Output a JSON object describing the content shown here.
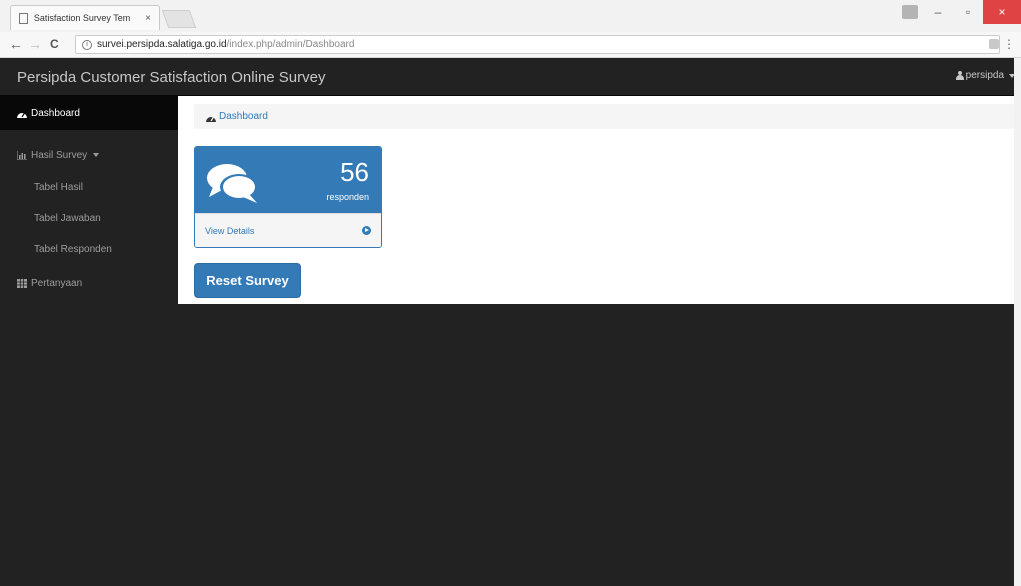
{
  "browser": {
    "tab_title": "Satisfaction Survey Tem",
    "tab_close": "×",
    "url_host": "survei.persipda.salatiga.go.id",
    "url_path": "/index.php/admin/Dashboard",
    "back": "←",
    "forward": "→",
    "reload": "C",
    "minimize": "–",
    "restore": "▫",
    "close": "×",
    "menu": "⋮"
  },
  "navbar": {
    "brand": "Persipda Customer Satisfaction Online Survey",
    "user": "persipda"
  },
  "sidebar": {
    "items": [
      {
        "label": "Dashboard",
        "icon": "dashboard-icon",
        "active": true
      },
      {
        "label": "Hasil Survey",
        "icon": "bar-chart-icon",
        "active": false,
        "has_caret": true
      },
      {
        "label": "Tabel Hasil",
        "sub": true
      },
      {
        "label": "Tabel Jawaban",
        "sub": true
      },
      {
        "label": "Tabel Responden",
        "sub": true
      },
      {
        "label": "Pertanyaan",
        "icon": "table-icon",
        "active": false
      }
    ]
  },
  "breadcrumb": {
    "label": "Dashboard"
  },
  "panel": {
    "count": "56",
    "count_label": "responden",
    "footer_link": "View Details",
    "icon": "comments-icon"
  },
  "reset_button": {
    "label": "Reset Survey"
  },
  "colors": {
    "primary": "#337ab7",
    "navbar": "#222222",
    "active_item": "#080808"
  }
}
